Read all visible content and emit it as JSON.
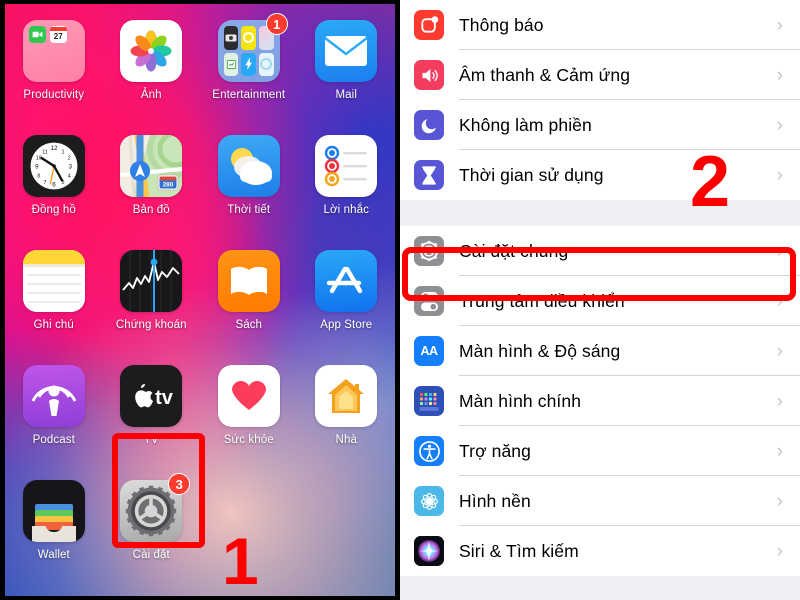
{
  "home_screen": {
    "apps": [
      {
        "label": "Productivity",
        "icon": "folder-productivity-icon",
        "badge": null
      },
      {
        "label": "Ảnh",
        "icon": "photos-app-icon",
        "badge": null
      },
      {
        "label": "Entertainment",
        "icon": "folder-entertainment-icon",
        "badge": "1"
      },
      {
        "label": "Mail",
        "icon": "mail-app-icon",
        "badge": null
      },
      {
        "label": "Đồng hồ",
        "icon": "clock-app-icon",
        "badge": null
      },
      {
        "label": "Bản đồ",
        "icon": "maps-app-icon",
        "badge": null
      },
      {
        "label": "Thời tiết",
        "icon": "weather-app-icon",
        "badge": null
      },
      {
        "label": "Lời nhắc",
        "icon": "reminders-app-icon",
        "badge": null
      },
      {
        "label": "Ghi chú",
        "icon": "notes-app-icon",
        "badge": null
      },
      {
        "label": "Chứng khoán",
        "icon": "stocks-app-icon",
        "badge": null
      },
      {
        "label": "Sách",
        "icon": "books-app-icon",
        "badge": null
      },
      {
        "label": "App Store",
        "icon": "appstore-app-icon",
        "badge": null
      },
      {
        "label": "Podcast",
        "icon": "podcasts-app-icon",
        "badge": null
      },
      {
        "label": "TV",
        "icon": "tv-app-icon",
        "badge": null
      },
      {
        "label": "Sức khỏe",
        "icon": "health-app-icon",
        "badge": null
      },
      {
        "label": "Nhà",
        "icon": "home-app-icon",
        "badge": null
      },
      {
        "label": "Wallet",
        "icon": "wallet-app-icon",
        "badge": null
      },
      {
        "label": "Cài đặt",
        "icon": "settings-app-icon",
        "badge": "3"
      }
    ],
    "maps_shield_number": "280",
    "calendar_mini_day": "27"
  },
  "settings": {
    "group_1": [
      {
        "label": "Thông báo",
        "icon": "notifications-icon",
        "chevron": "›"
      },
      {
        "label": "Âm thanh & Cảm ứng",
        "icon": "sounds-haptics-icon",
        "chevron": "›"
      },
      {
        "label": "Không làm phiền",
        "icon": "do-not-disturb-icon",
        "chevron": "›"
      },
      {
        "label": "Thời gian sử dụng",
        "icon": "screen-time-icon",
        "chevron": "›"
      }
    ],
    "group_2": [
      {
        "label": "Cài đặt chung",
        "icon": "general-settings-icon",
        "chevron": "›"
      },
      {
        "label": "Trung tâm điều khiển",
        "icon": "control-center-icon",
        "chevron": "›"
      },
      {
        "label": "Màn hình & Độ sáng",
        "icon": "display-brightness-icon",
        "chevron": "›"
      },
      {
        "label": "Màn hình chính",
        "icon": "home-screen-icon",
        "chevron": "›"
      },
      {
        "label": "Trợ năng",
        "icon": "accessibility-icon",
        "chevron": "›"
      },
      {
        "label": "Hình nền",
        "icon": "wallpaper-icon",
        "chevron": "›"
      },
      {
        "label": "Siri & Tìm kiếm",
        "icon": "siri-search-icon",
        "chevron": "›"
      }
    ],
    "display_icon_text": "AA"
  },
  "annotations": {
    "step_1": "1",
    "step_2": "2",
    "highlight_color": "#fc0000"
  }
}
